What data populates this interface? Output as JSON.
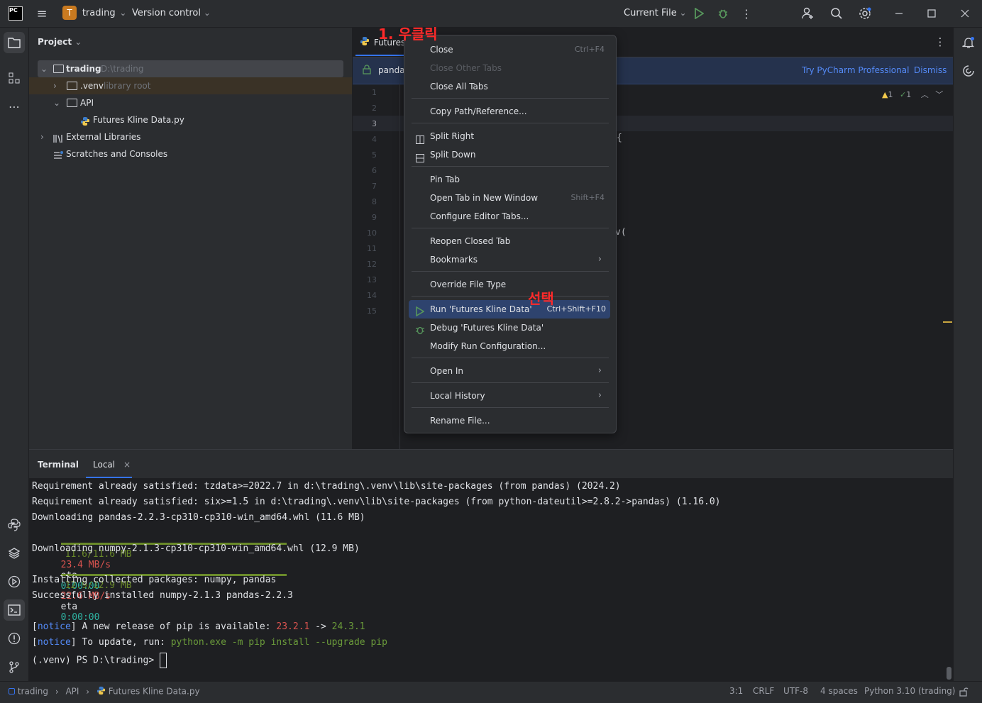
{
  "titlebar": {
    "project_letter": "T",
    "project_name": "trading",
    "vcs": "Version control",
    "run_config": "Current File"
  },
  "project_panel": {
    "title": "Project",
    "tree": [
      {
        "label": "trading",
        "hint": "D:\\trading"
      },
      {
        "label": ".venv",
        "hint": "library root"
      },
      {
        "label": "API",
        "hint": ""
      },
      {
        "label": "Futures Kline Data.py",
        "hint": ""
      },
      {
        "label": "External Libraries",
        "hint": ""
      },
      {
        "label": "Scratches and Consoles",
        "hint": ""
      }
    ]
  },
  "editor": {
    "tab_label": "Futures",
    "banner_text": "pandas",
    "banner_try": "Try PyCharm Professional",
    "banner_dismiss": "Dismiss",
    "warnings": "1",
    "checks": "1",
    "line_numbers": [
      "1",
      "2",
      "3",
      "4",
      "5",
      "6",
      "7",
      "8",
      "9",
      "10",
      "11",
      "12",
      "13",
      "14",
      "15"
    ],
    "code_fragments": {
      "l4": "{",
      "l10": "v("
    }
  },
  "annotations": {
    "right_click": "1. 우클릭",
    "select": "선택"
  },
  "context_menu": {
    "items": [
      {
        "label": "Close",
        "shortcut": "Ctrl+F4"
      },
      {
        "label": "Close Other Tabs",
        "shortcut": ""
      },
      {
        "label": "Close All Tabs",
        "shortcut": ""
      },
      {
        "label": "Copy Path/Reference...",
        "shortcut": ""
      },
      {
        "label": "Split Right",
        "shortcut": ""
      },
      {
        "label": "Split Down",
        "shortcut": ""
      },
      {
        "label": "Pin Tab",
        "shortcut": ""
      },
      {
        "label": "Open Tab in New Window",
        "shortcut": "Shift+F4"
      },
      {
        "label": "Configure Editor Tabs...",
        "shortcut": ""
      },
      {
        "label": "Reopen Closed Tab",
        "shortcut": ""
      },
      {
        "label": "Bookmarks",
        "shortcut": ""
      },
      {
        "label": "Override File Type",
        "shortcut": ""
      },
      {
        "label": "Run 'Futures Kline Data'",
        "shortcut": "Ctrl+Shift+F10"
      },
      {
        "label": "Debug 'Futures Kline Data'",
        "shortcut": ""
      },
      {
        "label": "Modify Run Configuration...",
        "shortcut": ""
      },
      {
        "label": "Open In",
        "shortcut": ""
      },
      {
        "label": "Local History",
        "shortcut": ""
      },
      {
        "label": "Rename File...",
        "shortcut": ""
      }
    ]
  },
  "terminal": {
    "tab_title": "Terminal",
    "session": "Local",
    "lines": {
      "l1": "Requirement already satisfied: tzdata>=2022.7 in d:\\trading\\.venv\\lib\\site-packages (from pandas) (2024.2)",
      "l2": "Requirement already satisfied: six>=1.5 in d:\\trading\\.venv\\lib\\site-packages (from python-dateutil>=2.8.2->pandas) (1.16.0)",
      "l3": "Downloading pandas-2.2.3-cp310-cp310-win_amd64.whl (11.6 MB)",
      "l5": "Downloading numpy-2.1.3-cp310-cp310-win_amd64.whl (12.9 MB)",
      "l7": "Installing collected packages: numpy, pandas",
      "l8": "Successfully installed numpy-2.1.3 pandas-2.2.3",
      "prompt": "(.venv) PS D:\\trading> "
    },
    "progress1": {
      "size": "11.6/11.6 MB",
      "speed": "23.4 MB/s",
      "eta_label": "eta",
      "eta": "0:00:00"
    },
    "progress2": {
      "size": "12.9/12.9 MB",
      "speed": "22.6 MB/s",
      "eta_label": "eta",
      "eta": "0:00:00"
    },
    "notice1": {
      "tag": "notice",
      "text": " A new release of pip is available: ",
      "old": "23.2.1",
      "arrow": " -> ",
      "new": "24.3.1"
    },
    "notice2": {
      "tag": "notice",
      "text": " To update, run: ",
      "cmd": "python.exe -m pip install --upgrade pip"
    }
  },
  "statusbar": {
    "crumbs": [
      "trading",
      "API",
      "Futures Kline Data.py"
    ],
    "position": "3:1",
    "line_sep": "CRLF",
    "encoding": "UTF-8",
    "indent": "4 spaces",
    "interpreter": "Python 3.10 (trading)"
  },
  "colors": {
    "accent": "#2e436e",
    "red_annotation": "#ff2a2a",
    "progress_green": "#6a8a2a"
  }
}
